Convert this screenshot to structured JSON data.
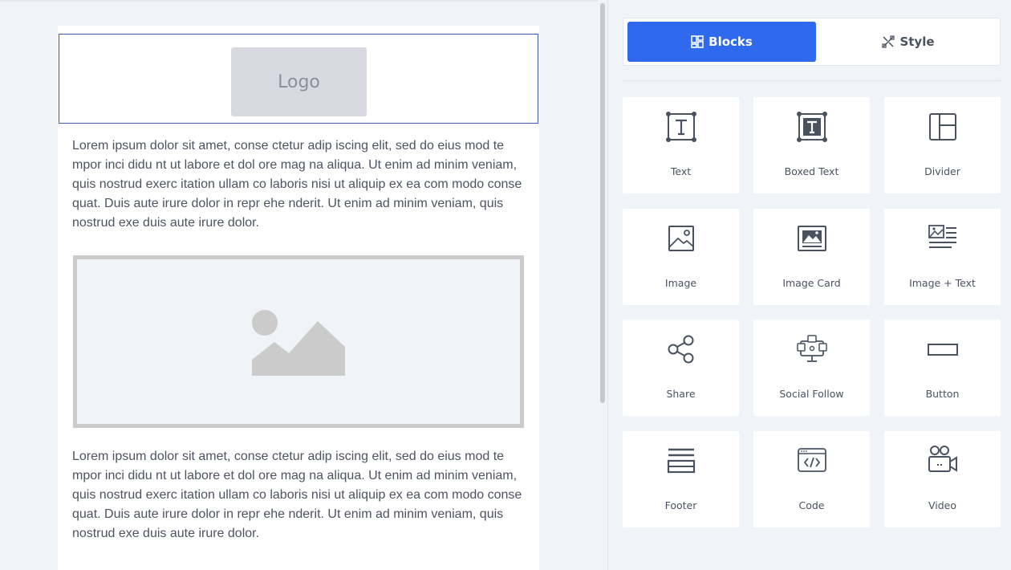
{
  "canvas": {
    "logo_label": "Logo",
    "paragraph_1": "Lorem ipsum dolor sit amet, conse ctetur adip iscing elit, sed do eius mod te mpor inci didu nt ut labore et dol ore mag na aliqua. Ut enim ad minim veniam, quis nostrud exerc itation ullam co laboris nisi ut aliquip ex ea com modo conse quat. Duis aute irure dolor in repr ehe nderit. Ut enim ad minim veniam, quis nostrud exe duis aute irure dolor.",
    "paragraph_2": "Lorem ipsum dolor sit amet, conse ctetur adip iscing elit, sed do eius mod te mpor inci didu nt ut labore et dol ore mag na aliqua. Ut enim ad minim veniam, quis nostrud exerc itation ullam co laboris nisi ut aliquip ex ea com modo conse quat. Duis aute irure dolor in repr ehe nderit. Ut enim ad minim veniam, quis nostrud exe duis aute irure dolor."
  },
  "panel": {
    "tabs": [
      {
        "label": "Blocks",
        "icon": "blocks-icon",
        "active": true
      },
      {
        "label": "Style",
        "icon": "style-icon",
        "active": false
      }
    ],
    "blocks": [
      {
        "label": "Text",
        "icon": "text-icon"
      },
      {
        "label": "Boxed Text",
        "icon": "boxed-text-icon"
      },
      {
        "label": "Divider",
        "icon": "divider-icon"
      },
      {
        "label": "Image",
        "icon": "image-icon"
      },
      {
        "label": "Image Card",
        "icon": "image-card-icon"
      },
      {
        "label": "Image + Text",
        "icon": "image-text-icon"
      },
      {
        "label": "Share",
        "icon": "share-icon"
      },
      {
        "label": "Social Follow",
        "icon": "social-follow-icon"
      },
      {
        "label": "Button",
        "icon": "button-icon"
      },
      {
        "label": "Footer",
        "icon": "footer-icon"
      },
      {
        "label": "Code",
        "icon": "code-icon"
      },
      {
        "label": "Video",
        "icon": "video-icon"
      }
    ]
  },
  "colors": {
    "accent": "#2f6aee",
    "selection_border": "#3d5fa8",
    "icon": "#4a5260",
    "placeholder": "#cbcbcb"
  }
}
